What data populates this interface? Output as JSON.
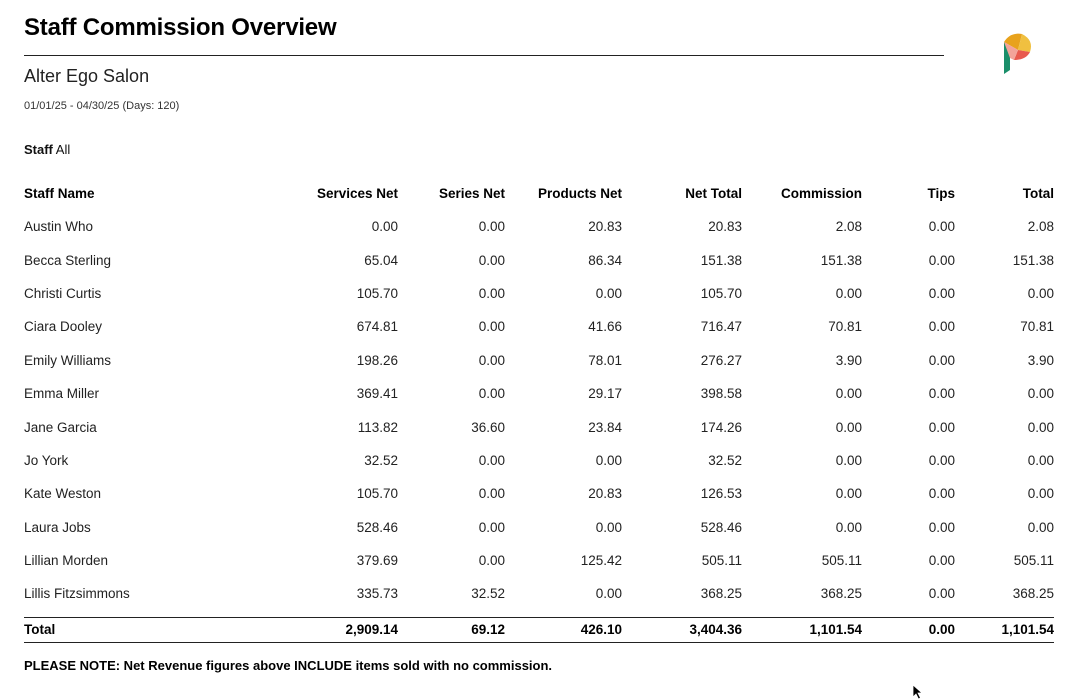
{
  "report": {
    "title": "Staff Commission Overview",
    "salon": "Alter Ego Salon",
    "date_range": "01/01/25 - 04/30/25 (Days: 120)",
    "filter_label": "Staff",
    "filter_value": "All",
    "note": "PLEASE NOTE: Net Revenue figures above INCLUDE items sold with no commission."
  },
  "logo": {
    "colors": [
      "#e8a21c",
      "#e85a4f",
      "#1a8f6a",
      "#4fa3a0"
    ]
  },
  "table": {
    "headers": [
      "Staff Name",
      "Services Net",
      "Series Net",
      "Products Net",
      "Net Total",
      "Commission",
      "Tips",
      "Total"
    ],
    "rows": [
      [
        "Austin Who",
        "0.00",
        "0.00",
        "20.83",
        "20.83",
        "2.08",
        "0.00",
        "2.08"
      ],
      [
        "Becca Sterling",
        "65.04",
        "0.00",
        "86.34",
        "151.38",
        "151.38",
        "0.00",
        "151.38"
      ],
      [
        "Christi Curtis",
        "105.70",
        "0.00",
        "0.00",
        "105.70",
        "0.00",
        "0.00",
        "0.00"
      ],
      [
        "Ciara Dooley",
        "674.81",
        "0.00",
        "41.66",
        "716.47",
        "70.81",
        "0.00",
        "70.81"
      ],
      [
        "Emily Williams",
        "198.26",
        "0.00",
        "78.01",
        "276.27",
        "3.90",
        "0.00",
        "3.90"
      ],
      [
        "Emma Miller",
        "369.41",
        "0.00",
        "29.17",
        "398.58",
        "0.00",
        "0.00",
        "0.00"
      ],
      [
        "Jane Garcia",
        "113.82",
        "36.60",
        "23.84",
        "174.26",
        "0.00",
        "0.00",
        "0.00"
      ],
      [
        "Jo York",
        "32.52",
        "0.00",
        "0.00",
        "32.52",
        "0.00",
        "0.00",
        "0.00"
      ],
      [
        "Kate Weston",
        "105.70",
        "0.00",
        "20.83",
        "126.53",
        "0.00",
        "0.00",
        "0.00"
      ],
      [
        "Laura Jobs",
        "528.46",
        "0.00",
        "0.00",
        "528.46",
        "0.00",
        "0.00",
        "0.00"
      ],
      [
        "Lillian Morden",
        "379.69",
        "0.00",
        "125.42",
        "505.11",
        "505.11",
        "0.00",
        "505.11"
      ],
      [
        "Lillis Fitzsimmons",
        "335.73",
        "32.52",
        "0.00",
        "368.25",
        "368.25",
        "0.00",
        "368.25"
      ]
    ],
    "total": [
      "Total",
      "2,909.14",
      "69.12",
      "426.10",
      "3,404.36",
      "1,101.54",
      "0.00",
      "1,101.54"
    ]
  }
}
